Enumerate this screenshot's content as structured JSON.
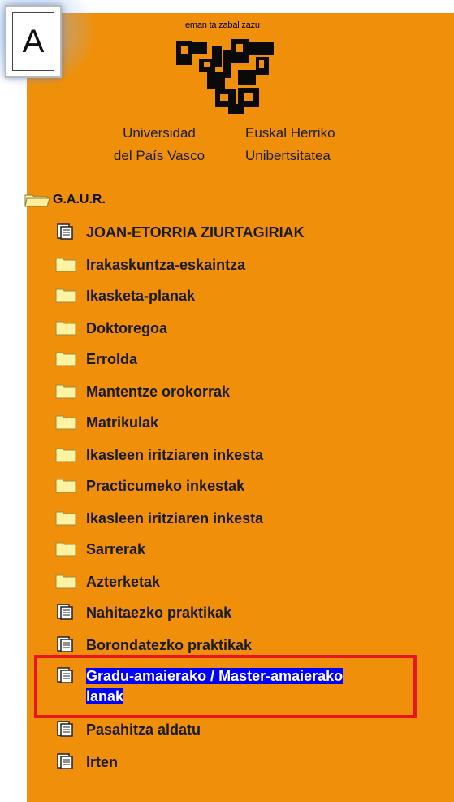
{
  "badge": {
    "letter": "A"
  },
  "header": {
    "motto": "eman ta zabal zazu",
    "university_es_line1": "Universidad",
    "university_es_line2": "del País Vasco",
    "university_eu_line1": "Euskal Herriko",
    "university_eu_line2": "Unibertsitatea"
  },
  "tree": {
    "root_label": "G.A.U.R.",
    "items": [
      {
        "label": "JOAN-ETORRIA ZIURTAGIRIAK",
        "icon": "document-icon"
      },
      {
        "label": "Irakaskuntza-eskaintza",
        "icon": "folder-icon"
      },
      {
        "label": "Ikasketa-planak",
        "icon": "folder-icon"
      },
      {
        "label": "Doktoregoa",
        "icon": "folder-icon"
      },
      {
        "label": "Errolda",
        "icon": "folder-icon"
      },
      {
        "label": "Mantentze orokorrak",
        "icon": "folder-icon"
      },
      {
        "label": "Matrikulak",
        "icon": "folder-icon"
      },
      {
        "label": "Ikasleen iritziaren inkesta",
        "icon": "folder-icon"
      },
      {
        "label": "Practicumeko inkestak",
        "icon": "folder-icon"
      },
      {
        "label": "Ikasleen iritziaren inkesta",
        "icon": "folder-icon"
      },
      {
        "label": "Sarrerak",
        "icon": "folder-icon"
      },
      {
        "label": "Azterketak",
        "icon": "folder-icon"
      },
      {
        "label": "Nahitaezko praktikak",
        "icon": "document-icon"
      },
      {
        "label": "Borondatezko praktikak",
        "icon": "document-icon"
      },
      {
        "label_line1": "Gradu-amaierako / Master-amaierako",
        "label_line2": "lanak",
        "icon": "document-icon",
        "selected": true
      },
      {
        "label": "Pasahitza aldatu",
        "icon": "document-icon"
      },
      {
        "label": "Irten",
        "icon": "document-icon"
      }
    ]
  },
  "colors": {
    "panel": "#f0900a",
    "selection": "#0000ff",
    "highlight_box": "#e8171d"
  }
}
